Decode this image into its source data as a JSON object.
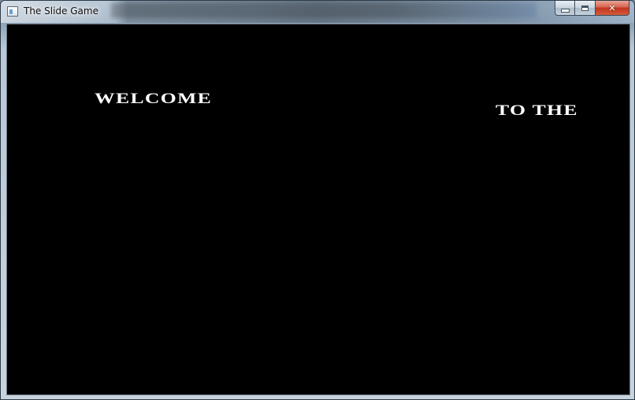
{
  "window": {
    "title": "The Slide Game",
    "icon": "app-window-icon",
    "buttons": {
      "minimize": "minimize-icon",
      "maximize": "maximize-icon",
      "close_label": "✕"
    }
  },
  "game": {
    "background_color": "#000000",
    "text_color": "#ffffff",
    "welcome_text": "WELCOME",
    "to_the_text": "TO THE"
  }
}
